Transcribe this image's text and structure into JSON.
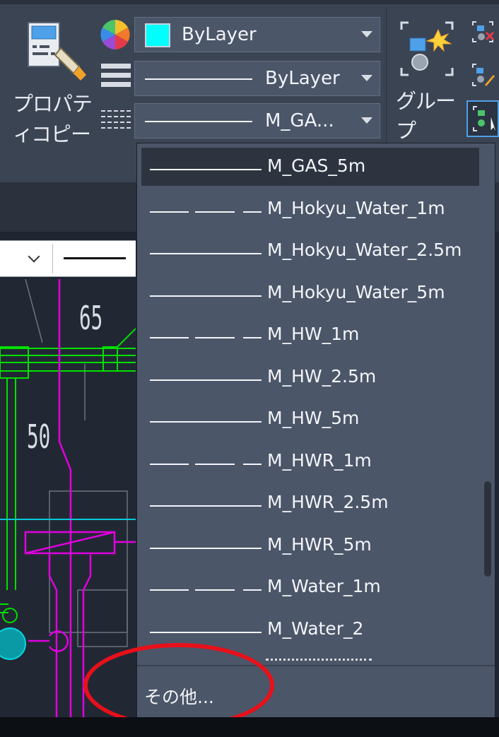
{
  "ribbon": {
    "properties_copy_label_line1": "プロパティ",
    "properties_copy_label_line2": "コピー",
    "group_label": "グループ",
    "color_combo": {
      "value": "ByLayer",
      "swatch_color": "#00ffff"
    },
    "linetype_combo": {
      "value": "ByLayer"
    },
    "lineweight_combo": {
      "value": "M_GA..."
    }
  },
  "canvas": {
    "dimension_labels": [
      "65",
      "50"
    ]
  },
  "dropdown": {
    "items": [
      {
        "label": "M_GAS_5m",
        "style": "solid",
        "selected": true
      },
      {
        "label": "M_Hokyu_Water_1m",
        "style": "dashed",
        "selected": false
      },
      {
        "label": "M_Hokyu_Water_2.5m",
        "style": "solid",
        "selected": false
      },
      {
        "label": "M_Hokyu_Water_5m",
        "style": "solid",
        "selected": false
      },
      {
        "label": "M_HW_1m",
        "style": "dashed",
        "selected": false
      },
      {
        "label": "M_HW_2.5m",
        "style": "solid",
        "selected": false
      },
      {
        "label": "M_HW_5m",
        "style": "solid",
        "selected": false
      },
      {
        "label": "M_HWR_1m",
        "style": "dashed",
        "selected": false
      },
      {
        "label": "M_HWR_2.5m",
        "style": "solid",
        "selected": false
      },
      {
        "label": "M_HWR_5m",
        "style": "solid",
        "selected": false
      },
      {
        "label": "M_Water_1m",
        "style": "dashed",
        "selected": false
      },
      {
        "label": "M_Water_2",
        "style": "solid",
        "selected": false
      }
    ],
    "other_label": "その他..."
  },
  "colors": {
    "highlight_ellipse": "#e8101a",
    "panel_bg": "#4c5669"
  }
}
